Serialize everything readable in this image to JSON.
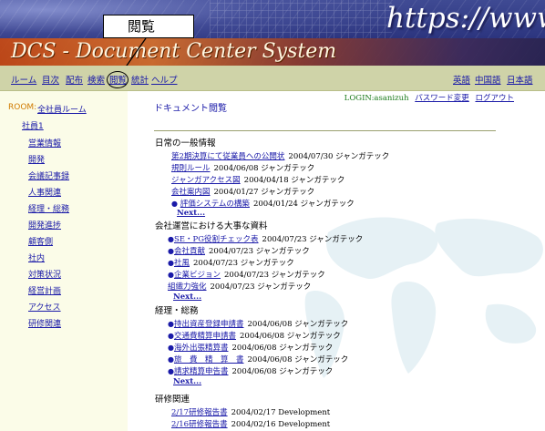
{
  "header": {
    "title": "DCS - Document Center System",
    "url_decoration": "https://www.",
    "callout": "閲覧"
  },
  "nav": {
    "left": [
      "ルーム",
      "目次",
      "配布",
      "検索",
      "閲覧",
      "統計",
      "ヘルプ"
    ],
    "right": [
      "英語",
      "中国語",
      "日本語"
    ]
  },
  "sidebar": {
    "room_label": "ROOM:",
    "room_name": "全社員ルーム",
    "group": "社員1",
    "categories": [
      "営業情報",
      "開発",
      "会議記事録",
      "人事関連",
      "経理・総務",
      "開発進捗",
      "顧客側",
      "社内",
      "対策状況",
      "経営計画",
      "アクセス",
      "研修関連"
    ]
  },
  "main": {
    "login_text": "LOGIN:asanizuh",
    "password_link": "パスワード変更",
    "logout_link": "ログアウト",
    "page_title": "ドキュメント閲覧",
    "next_label": "Next...",
    "sections": [
      {
        "title": "日常の一般情報",
        "docs": [
          {
            "title": "第2期決算にて従業員への公開状",
            "meta": "2004/07/30 ジャンガテック"
          },
          {
            "title": "規則ルール",
            "meta": "2004/06/08 ジャンガテック"
          },
          {
            "title": "ジャンガアクセス図",
            "meta": "2004/04/18 ジャンガテック"
          },
          {
            "title": "会社案内図",
            "meta": "2004/01/27 ジャンガテック"
          },
          {
            "title": "評価システムの構築",
            "meta": "2004/01/24 ジャンガテック"
          }
        ]
      },
      {
        "title": "会社運営における大事な資料",
        "docs": [
          {
            "title": "SE・PG役割チェック表",
            "meta": "2004/07/23 ジャンガテック"
          },
          {
            "title": "会社貢献",
            "meta": "2004/07/23 ジャンガテック"
          },
          {
            "title": "社風",
            "meta": "2004/07/23 ジャンガテック"
          },
          {
            "title": "企業ビジョン",
            "meta": "2004/07/23 ジャンガテック"
          },
          {
            "title": "組織力強化",
            "meta": "2004/07/23 ジャンガテック"
          }
        ]
      },
      {
        "title": "経理・総務",
        "docs": [
          {
            "title": "持出資産登録申請書",
            "meta": "2004/06/08 ジャンガテック"
          },
          {
            "title": "交通費精算申請書",
            "meta": "2004/06/08 ジャンガテック"
          },
          {
            "title": "海外出張精算書",
            "meta": "2004/06/08 ジャンガテック"
          },
          {
            "title": "旅　費　精　算　書",
            "meta": "2004/06/08 ジャンガテック"
          },
          {
            "title": "請求精算申告書",
            "meta": "2004/06/08 ジャンガテック"
          }
        ]
      },
      {
        "title": "研修関連",
        "docs": [
          {
            "title": "2/17研修報告書",
            "meta": "2004/02/17 Development"
          },
          {
            "title": "2/16研修報告書",
            "meta": "2004/02/16 Development"
          }
        ]
      }
    ]
  },
  "colors": {
    "link": "#1a1aa8",
    "nav_bar": "#cfd3a8",
    "sidebar_bg": "#fbfce8",
    "room_label": "#d07a00",
    "login_text": "#1a7a1a"
  }
}
